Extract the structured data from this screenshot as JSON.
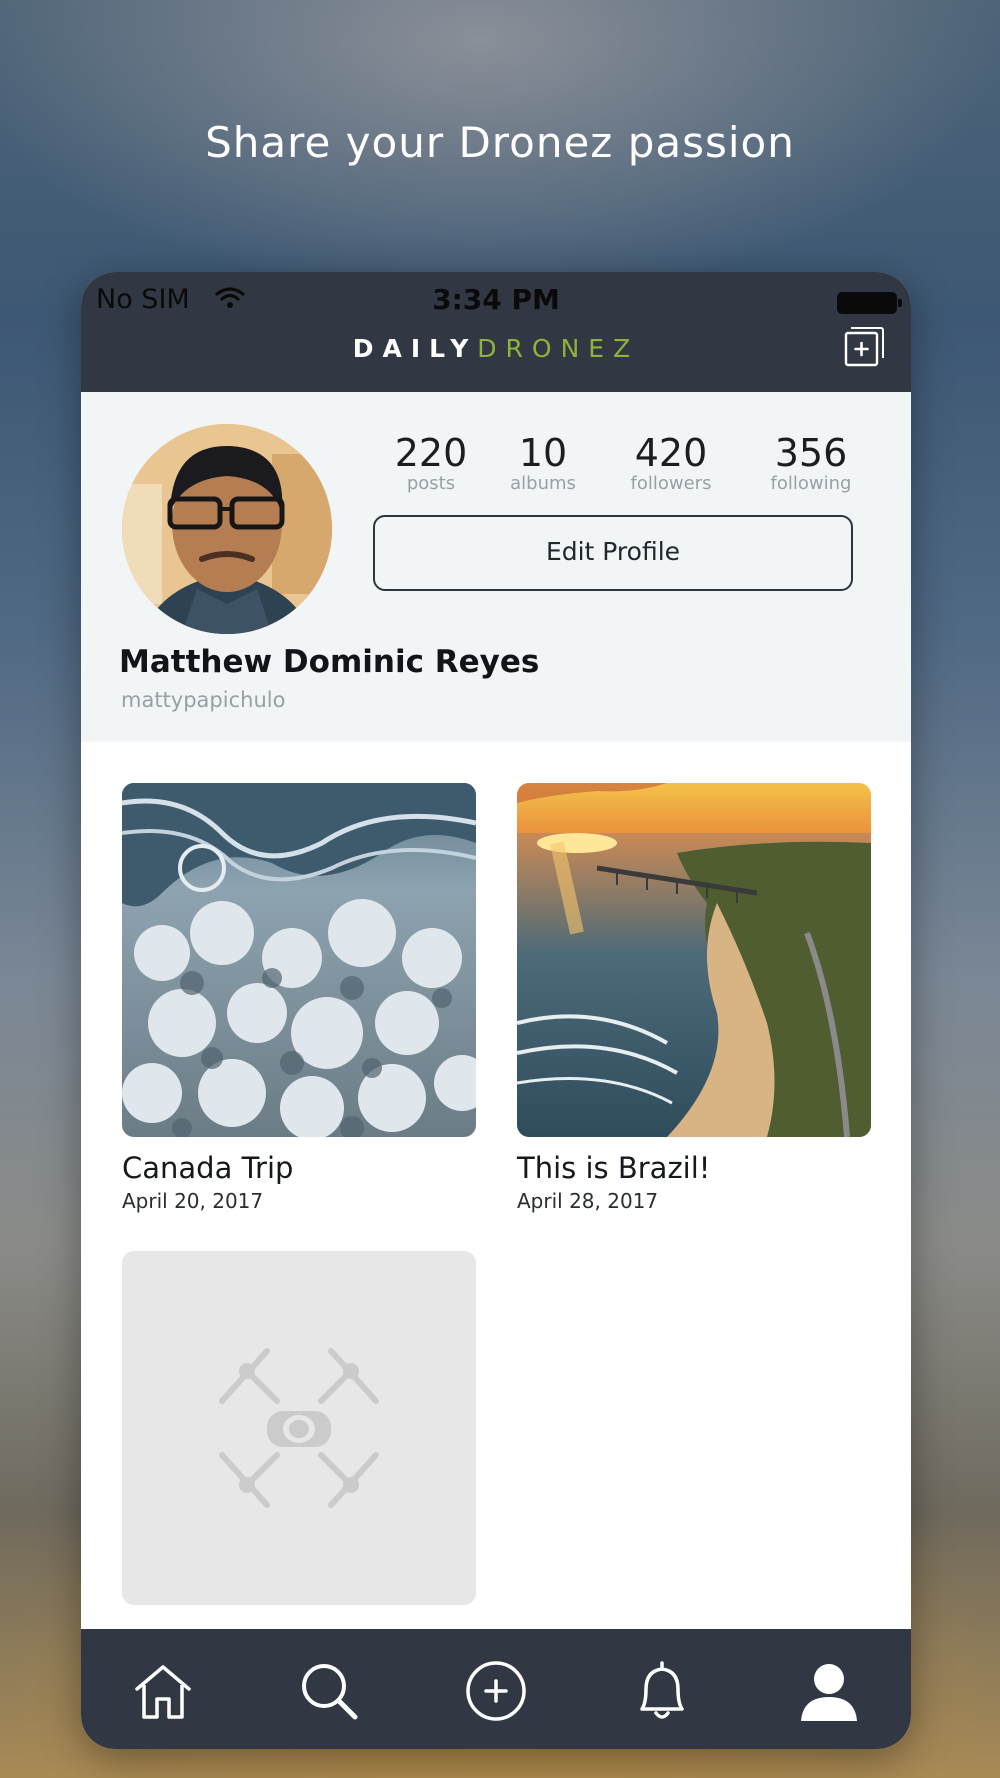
{
  "tagline": "Share your Dronez passion",
  "status_bar": {
    "carrier": "No SIM",
    "time": "3:34 PM"
  },
  "brand": {
    "part1": "DAILY",
    "part2": "DRONEZ"
  },
  "profile": {
    "stats": [
      {
        "value": "220",
        "label": "posts"
      },
      {
        "value": "10",
        "label": "albums"
      },
      {
        "value": "420",
        "label": "followers"
      },
      {
        "value": "356",
        "label": "following"
      }
    ],
    "edit_label": "Edit Profile",
    "full_name": "Matthew Dominic Reyes",
    "username": "mattypapichulo"
  },
  "albums": [
    {
      "title": "Canada Trip",
      "date": "April 20, 2017"
    },
    {
      "title": "This is Brazil!",
      "date": "April 28, 2017"
    }
  ],
  "tabs": [
    "home-icon",
    "search-icon",
    "add-circle-icon",
    "bell-icon",
    "profile-icon"
  ],
  "colors": {
    "bar": "#313843",
    "accent": "#8fb33a",
    "profile_bg": "#f2f5f6"
  }
}
